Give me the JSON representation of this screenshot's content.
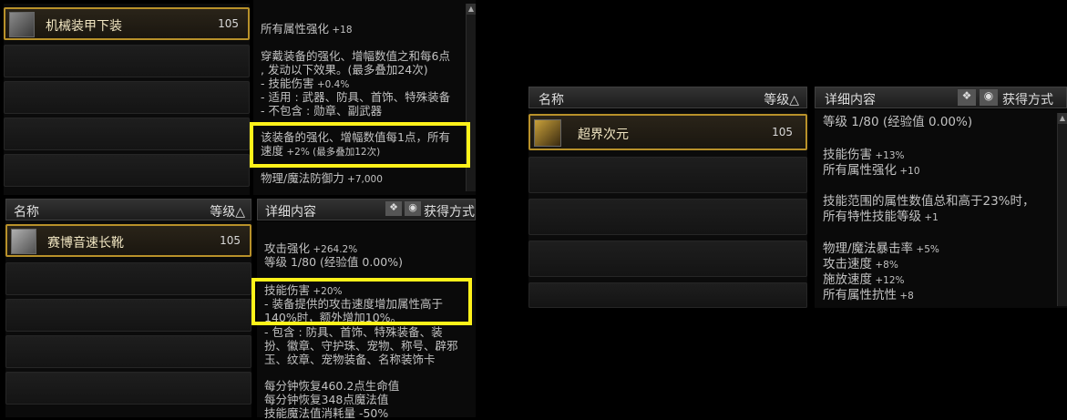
{
  "panel1": {
    "item": {
      "name": "机械装甲下装",
      "level": "105"
    },
    "detail_lines": [
      {
        "t": "所有属性强化",
        "v": " +18"
      },
      {
        "t": "穿戴装备的强化、增幅数值之和每6点\n, 发动以下效果。(最多叠加24次)"
      },
      {
        "t": "- 技能伤害",
        "v": " +0.4%"
      },
      {
        "t": "- 适用 : 武器、防具、首饰、特殊装备\n- 不包含 : 勋章、副武器"
      },
      {
        "t": "该装备的强化、增幅数值每1点，所有\n速度",
        "v": " +2% (最多叠加12次)"
      },
      {
        "t": "物理/魔法防御力",
        "v": " +7,000"
      }
    ]
  },
  "panel2": {
    "header": {
      "name": "名称",
      "level": "等级△",
      "detail": "详细内容",
      "obtain": "获得方式"
    },
    "item": {
      "name": "赛博音速长靴",
      "level": "105"
    },
    "detail_lines": [
      {
        "t": "攻击强化",
        "v": " +264.2%"
      },
      {
        "t": "等级 1/80 (经验值 0.00%)"
      },
      {
        "t": "技能伤害",
        "v": " +20%"
      },
      {
        "t": "- 装备提供的攻击速度增加属性高于\n140%时，额外增加10%。"
      },
      {
        "t": "- 包含 : 防具、首饰、特殊装备、装\n扮、徽章、守护珠、宠物、称号、辟邪\n玉、纹章、宠物装备、名称装饰卡"
      },
      {
        "t": "每分钟恢复460.2点生命值\n每分钟恢复348点魔法值\n技能魔法值消耗量 -50%"
      }
    ]
  },
  "panel3": {
    "header": {
      "name": "名称",
      "level": "等级△",
      "detail": "详细内容",
      "obtain": "获得方式"
    },
    "item": {
      "name": "超界次元",
      "level": "105"
    },
    "detail_lines": [
      {
        "t": "等级 1/80 (经验值 0.00%)"
      },
      {
        "t": "技能伤害",
        "v": " +13%"
      },
      {
        "t": "所有属性强化",
        "v": " +10"
      },
      {
        "t": "技能范围的属性数值总和高于23%时，"
      },
      {
        "t": "所有特性技能等级",
        "v": " +1"
      },
      {
        "t": "物理/魔法暴击率",
        "v": " +5%"
      },
      {
        "t": "攻击速度",
        "v": " +8%"
      },
      {
        "t": "施放速度",
        "v": " +12%"
      },
      {
        "t": "所有属性抗性",
        "v": " +8"
      }
    ]
  },
  "colors": {
    "highlight": "#fff21a",
    "selected_border": "#b8912a"
  }
}
